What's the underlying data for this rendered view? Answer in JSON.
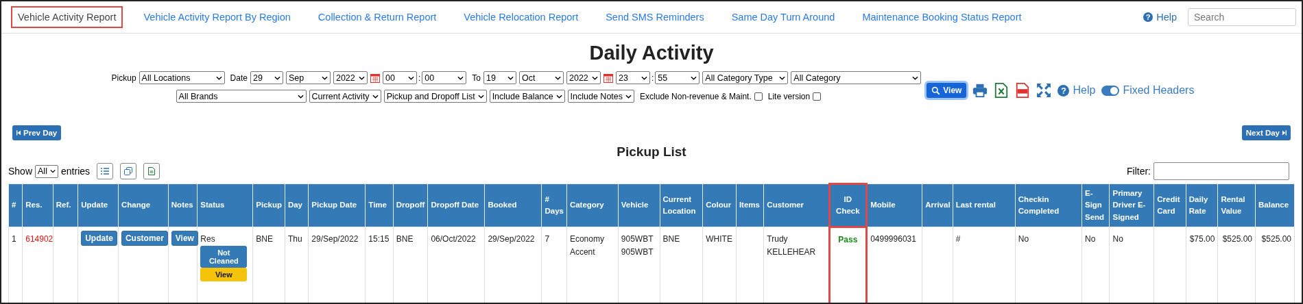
{
  "nav": {
    "tabs": [
      {
        "label": "Vehicle Activity Report",
        "selected": true
      },
      {
        "label": "Vehicle Activity Report By Region",
        "selected": false
      },
      {
        "label": "Collection & Return Report",
        "selected": false
      },
      {
        "label": "Vehicle Relocation Report",
        "selected": false
      },
      {
        "label": "Send SMS Reminders",
        "selected": false
      },
      {
        "label": "Same Day Turn Around",
        "selected": false
      },
      {
        "label": "Maintenance Booking Status Report",
        "selected": false
      }
    ],
    "help_icon": "?",
    "help": "Help",
    "search": {
      "placeholder": "Search"
    }
  },
  "title": "Daily Activity",
  "filters": {
    "row1": [
      {
        "kind": "label",
        "text": "Pickup"
      },
      {
        "kind": "select",
        "value": "All Locations"
      },
      {
        "kind": "label",
        "text": "Date"
      },
      {
        "kind": "select",
        "value": "29"
      },
      {
        "kind": "select",
        "value": "Sep"
      },
      {
        "kind": "select",
        "value": "2022"
      },
      {
        "kind": "calendar"
      },
      {
        "kind": "select",
        "value": "00"
      },
      {
        "kind": "colon",
        "text": ":"
      },
      {
        "kind": "select",
        "value": "00"
      },
      {
        "kind": "label",
        "text": "To"
      },
      {
        "kind": "select",
        "value": "19"
      },
      {
        "kind": "select",
        "value": "Oct"
      },
      {
        "kind": "select",
        "value": "2022"
      },
      {
        "kind": "calendar"
      },
      {
        "kind": "select",
        "value": "23"
      },
      {
        "kind": "colon",
        "text": ":"
      },
      {
        "kind": "select",
        "value": "55"
      },
      {
        "kind": "select",
        "value": "All Category Type"
      },
      {
        "kind": "select",
        "value": "All Category"
      }
    ],
    "row2": [
      {
        "kind": "select",
        "value": "All Brands"
      },
      {
        "kind": "select",
        "value": "Current Activity"
      },
      {
        "kind": "select",
        "value": "Pickup and Dropoff List"
      },
      {
        "kind": "select",
        "value": "Include Balance"
      },
      {
        "kind": "select",
        "value": "Include Notes"
      },
      {
        "kind": "checkbox",
        "text": "Exclude Non-revenue & Maint.",
        "checked": false
      },
      {
        "kind": "checkbox",
        "text": "Lite version",
        "checked": false
      }
    ],
    "view_button": "View",
    "help_icon": "?",
    "help": "Help",
    "fixed_headers": {
      "label": "Fixed Headers",
      "on": true
    }
  },
  "prev_day": "Prev Day",
  "next_day": "Next Day",
  "list_title": "Pickup List",
  "show": {
    "before": "Show",
    "value": "All",
    "after": "entries"
  },
  "filter": {
    "label": "Filter:"
  },
  "table": {
    "columns": [
      {
        "label": "#",
        "highlighted": false
      },
      {
        "label": "Res.",
        "highlighted": false
      },
      {
        "label": "Ref.",
        "highlighted": false
      },
      {
        "label": "Update",
        "highlighted": false
      },
      {
        "label": "Change",
        "highlighted": false
      },
      {
        "label": "Notes",
        "highlighted": false
      },
      {
        "label": "Status",
        "highlighted": false
      },
      {
        "label": "Pickup",
        "highlighted": false
      },
      {
        "label": "Day",
        "highlighted": false
      },
      {
        "label": "Pickup Date",
        "highlighted": false
      },
      {
        "label": "Time",
        "highlighted": false
      },
      {
        "label": "Dropoff",
        "highlighted": false
      },
      {
        "label": "Dropoff Date",
        "highlighted": false
      },
      {
        "label": "Booked",
        "highlighted": false
      },
      {
        "label": "# Days",
        "highlighted": false
      },
      {
        "label": "Category",
        "highlighted": false
      },
      {
        "label": "Vehicle",
        "highlighted": false
      },
      {
        "label": "Current Location",
        "highlighted": false
      },
      {
        "label": "Colour",
        "highlighted": false
      },
      {
        "label": "Items",
        "highlighted": false
      },
      {
        "label": "Customer",
        "highlighted": false
      },
      {
        "label": "ID Check",
        "highlighted": true
      },
      {
        "label": "Mobile",
        "highlighted": false
      },
      {
        "label": "Arrival",
        "highlighted": false
      },
      {
        "label": "Last rental",
        "highlighted": false
      },
      {
        "label": "Checkin Completed",
        "highlighted": false
      },
      {
        "label": "E-Sign Send",
        "highlighted": false
      },
      {
        "label": "Primary Driver E-Signed",
        "highlighted": false
      },
      {
        "label": "Credit Card",
        "highlighted": false
      },
      {
        "label": "Daily Rate",
        "highlighted": false
      },
      {
        "label": "Rental Value",
        "highlighted": false
      },
      {
        "label": "Balance",
        "highlighted": false
      }
    ],
    "rows": [
      [
        {
          "kind": "text",
          "lines": [
            "1"
          ]
        },
        {
          "kind": "link",
          "lines": [
            "614902"
          ]
        },
        {
          "kind": "text"
        },
        {
          "kind": "button",
          "lines": [
            "Update"
          ]
        },
        {
          "kind": "button",
          "lines": [
            "Customer"
          ]
        },
        {
          "kind": "button",
          "lines": [
            "View"
          ]
        },
        {
          "kind": "status",
          "lines": [
            "Res",
            "Not Cleaned",
            "View"
          ]
        },
        {
          "kind": "text",
          "lines": [
            "BNE"
          ]
        },
        {
          "kind": "text",
          "lines": [
            "Thu"
          ]
        },
        {
          "kind": "text",
          "lines": [
            "29/Sep/2022"
          ]
        },
        {
          "kind": "text",
          "lines": [
            "15:15"
          ]
        },
        {
          "kind": "text",
          "lines": [
            "BNE"
          ]
        },
        {
          "kind": "text",
          "lines": [
            "06/Oct/2022"
          ]
        },
        {
          "kind": "text",
          "lines": [
            "29/Sep/2022"
          ]
        },
        {
          "kind": "text",
          "lines": [
            "7"
          ]
        },
        {
          "kind": "text",
          "lines": [
            "Economy",
            "Accent"
          ]
        },
        {
          "kind": "text",
          "lines": [
            "905WBT",
            "905WBT"
          ]
        },
        {
          "kind": "text",
          "lines": [
            "BNE"
          ]
        },
        {
          "kind": "text",
          "lines": [
            "WHITE"
          ]
        },
        {
          "kind": "text"
        },
        {
          "kind": "text",
          "lines": [
            "Trudy",
            "KELLEHEAR"
          ]
        },
        {
          "kind": "pass",
          "lines": [
            "Pass"
          ]
        },
        {
          "kind": "text",
          "lines": [
            "0499996031"
          ]
        },
        {
          "kind": "text"
        },
        {
          "kind": "text",
          "lines": [
            "#"
          ]
        },
        {
          "kind": "text",
          "lines": [
            "No"
          ]
        },
        {
          "kind": "text",
          "lines": [
            "No"
          ]
        },
        {
          "kind": "text",
          "lines": [
            "No"
          ]
        },
        {
          "kind": "text"
        },
        {
          "kind": "money",
          "lines": [
            "$75.00"
          ]
        },
        {
          "kind": "money",
          "lines": [
            "$525.00"
          ]
        },
        {
          "kind": "money",
          "lines": [
            "$525.00"
          ]
        }
      ]
    ]
  }
}
